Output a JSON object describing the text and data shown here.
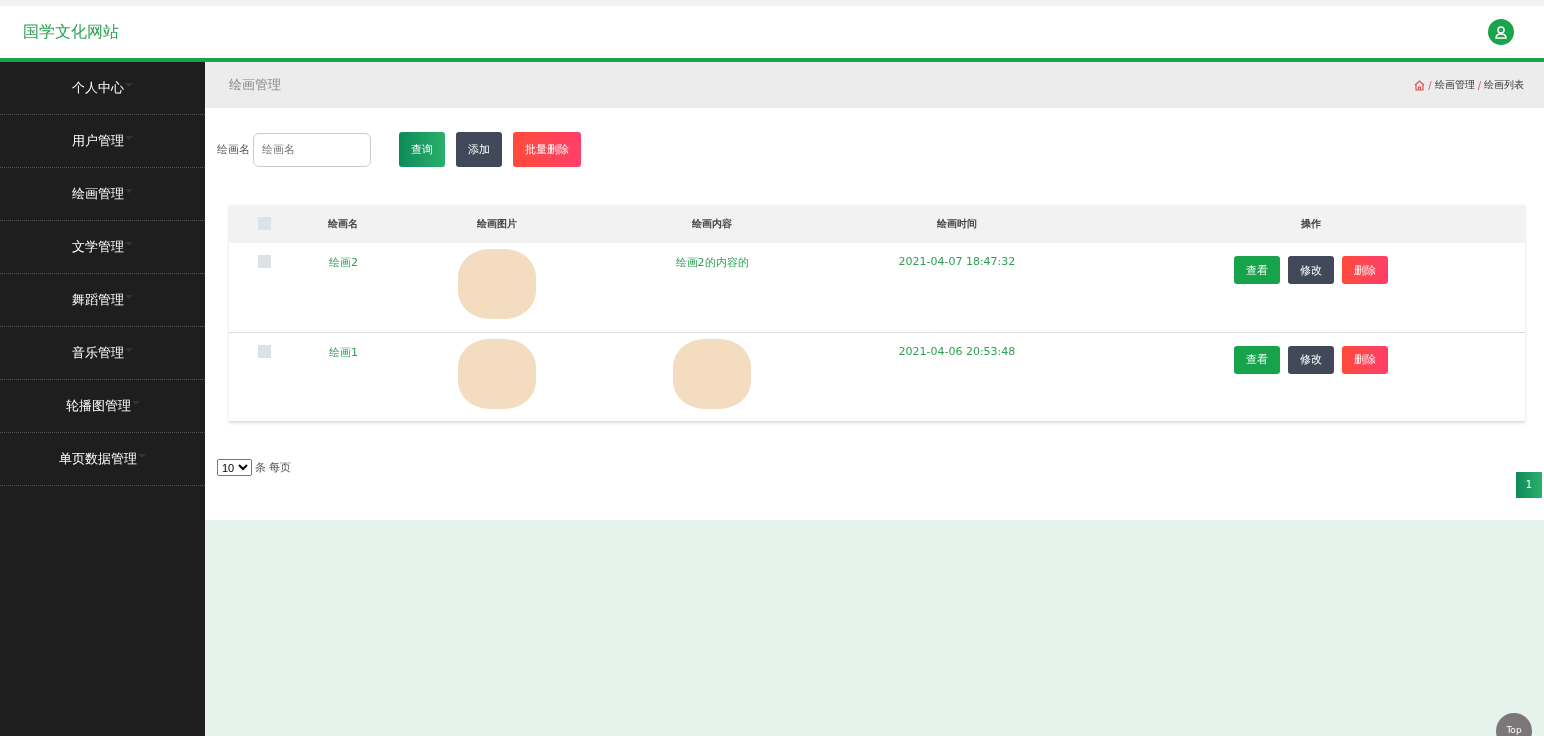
{
  "header": {
    "site_title": "国学文化网站"
  },
  "sidebar": {
    "items": [
      {
        "label": "个人中心",
        "expanded": false
      },
      {
        "label": "用户管理",
        "expanded": false
      },
      {
        "label": "绘画管理",
        "expanded": false
      },
      {
        "label": "文学管理",
        "expanded": false
      },
      {
        "label": "舞蹈管理",
        "expanded": false
      },
      {
        "label": "音乐管理",
        "expanded": false
      },
      {
        "label": "轮播图管理",
        "expanded": false
      },
      {
        "label": "单页数据管理",
        "expanded": false
      }
    ]
  },
  "page_header": {
    "title": "绘画管理",
    "breadcrumb": [
      {
        "separator": "/",
        "label": "绘画管理"
      },
      {
        "separator": "/",
        "label": "绘画列表"
      }
    ]
  },
  "search": {
    "label": "绘画名",
    "placeholder": "绘画名"
  },
  "buttons": [
    {
      "label": "查询",
      "kind": "query"
    },
    {
      "label": "添加",
      "kind": "add"
    },
    {
      "label": "批量删除",
      "kind": "delete"
    }
  ],
  "table": {
    "select_all_checked": false,
    "columns": [
      "绘画名",
      "绘画图片",
      "绘画内容",
      "绘画时间",
      "操作"
    ],
    "rows": [
      {
        "checked": false,
        "name": "绘画2",
        "content": {
          "kind": "text",
          "text": "绘画2的内容的"
        },
        "time": "2021-04-07 18:47:32",
        "actions": [
          {
            "label": "查看",
            "kind": "view"
          },
          {
            "label": "修改",
            "kind": "edit"
          },
          {
            "label": "删除",
            "kind": "delete"
          }
        ]
      },
      {
        "checked": false,
        "name": "绘画1",
        "content": {
          "kind": "image"
        },
        "time": "2021-04-06 20:53:48",
        "actions": [
          {
            "label": "查看",
            "kind": "view"
          },
          {
            "label": "修改",
            "kind": "edit"
          },
          {
            "label": "删除",
            "kind": "delete"
          }
        ]
      }
    ]
  },
  "pagination": {
    "page_size": "10",
    "page_size_label": "条 每页",
    "pages": [
      {
        "label": "1",
        "selected": true
      }
    ]
  },
  "back_to_top": "Top"
}
